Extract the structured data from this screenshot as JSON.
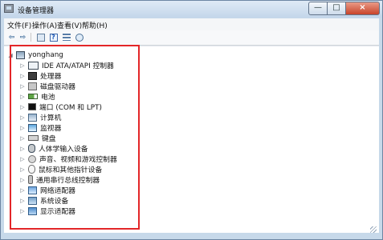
{
  "window": {
    "title": "设备管理器",
    "controls": {
      "minimize": "—",
      "maximize": "□",
      "close": "×"
    }
  },
  "menu": {
    "items": [
      "文件(F)",
      "操作(A)",
      "查看(V)",
      "帮助(H)"
    ]
  },
  "toolbar": {
    "back": "⇦",
    "forward": "⇨"
  },
  "tree": {
    "root": "yonghang",
    "items": [
      "IDE ATA/ATAPI 控制器",
      "处理器",
      "磁盘驱动器",
      "电池",
      "端口 (COM 和 LPT)",
      "计算机",
      "监视器",
      "键盘",
      "人体学输入设备",
      "声音、视频和游戏控制器",
      "鼠标和其他指针设备",
      "通用串行总线控制器",
      "网络适配器",
      "系统设备",
      "显示适配器"
    ]
  }
}
